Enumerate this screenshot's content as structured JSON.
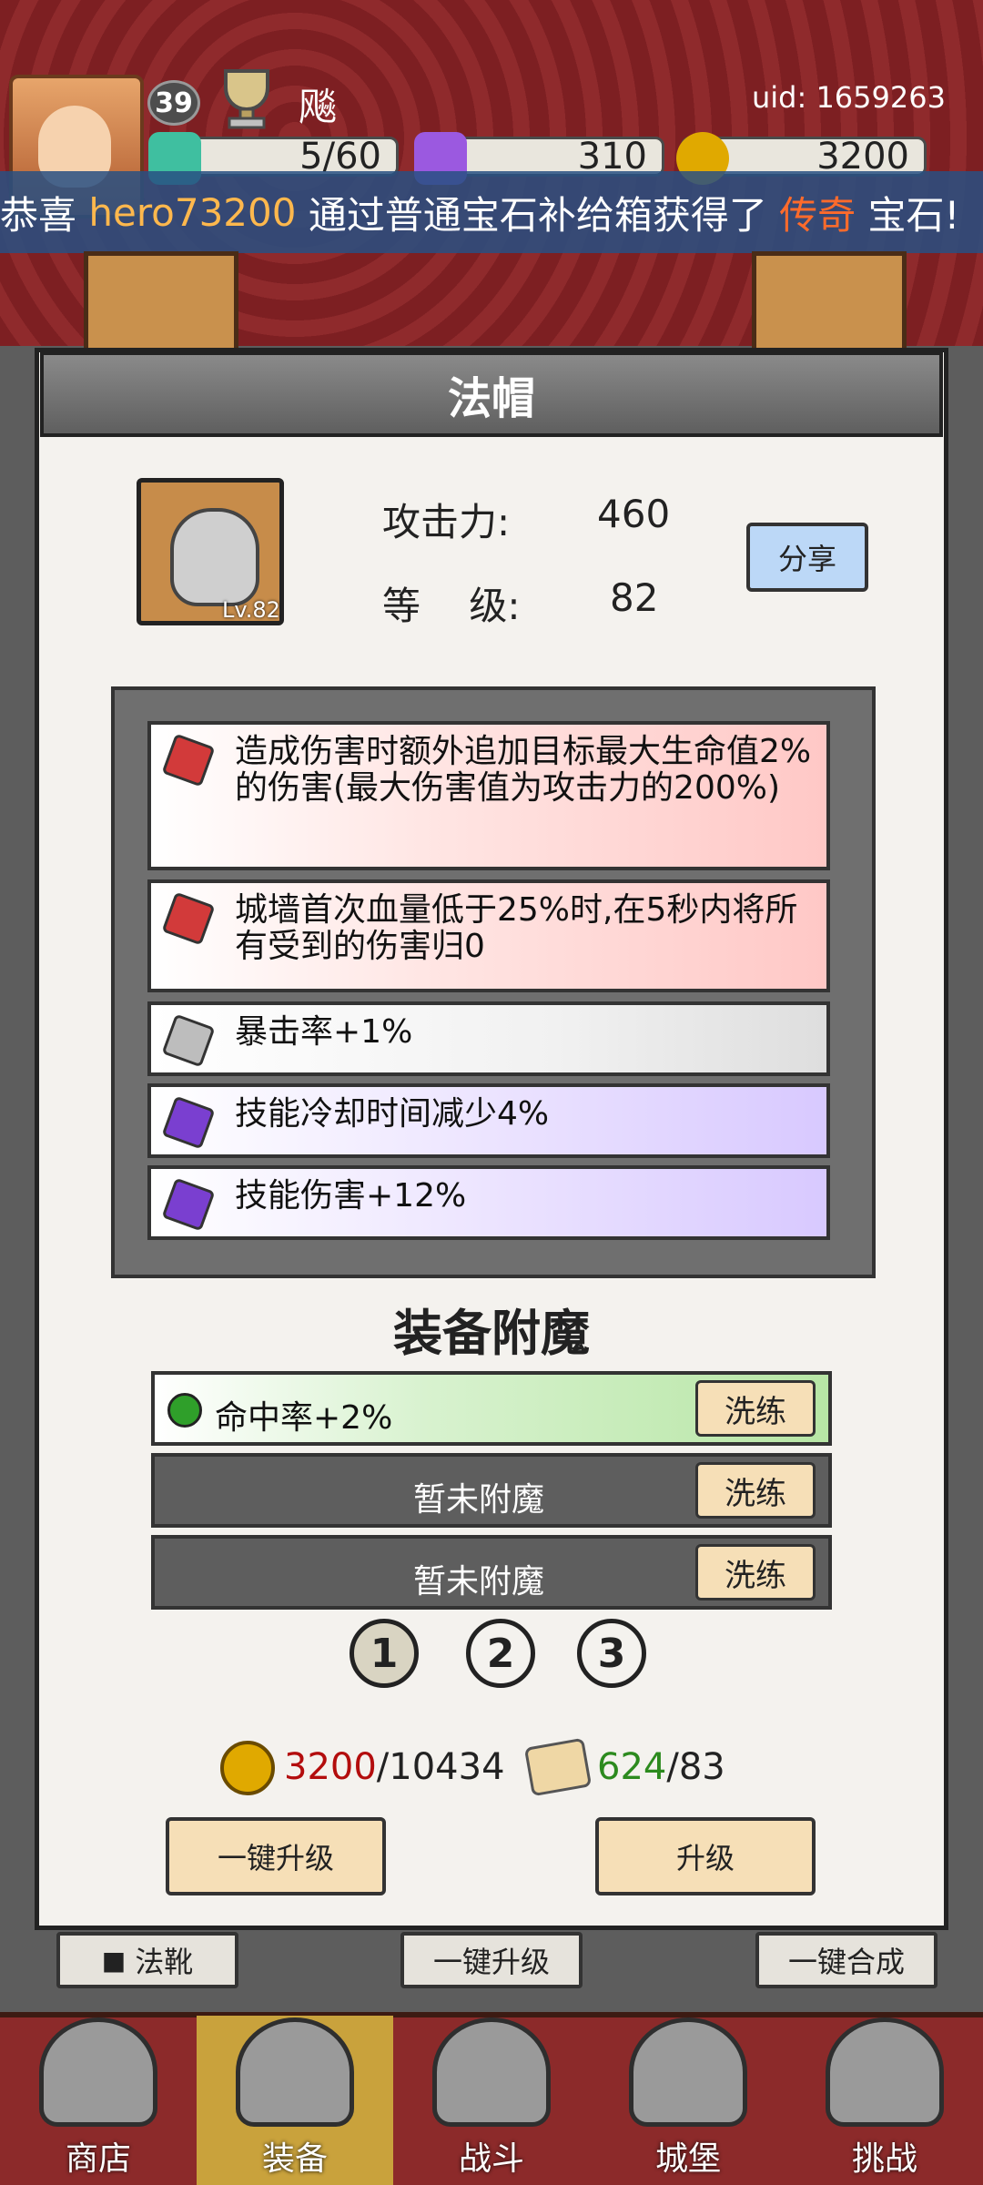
{
  "header": {
    "player_level": "39",
    "player_name": "飚",
    "uid": "uid: 1659263",
    "resources": [
      {
        "icon": "energy-gem-icon",
        "value": "5/60",
        "color": "#3fbfa0"
      },
      {
        "icon": "purple-diamond-icon",
        "value": "310",
        "color": "#9b59e0"
      },
      {
        "icon": "gold-coin-icon",
        "value": "3200",
        "color": "#e0a900"
      }
    ]
  },
  "broadcast": {
    "prefix": "恭喜 ",
    "player": "hero73200",
    "middle": " 通过普通宝石补给箱获得了 ",
    "rarity": "传奇",
    "suffix": " 宝石!"
  },
  "dialog": {
    "title": "法帽",
    "item_level": "Lv.82",
    "attack_label": "攻击力:",
    "attack_value": "460",
    "grade_label": "等    级:",
    "grade_value": "82",
    "share_label": "分享"
  },
  "affixes": [
    {
      "text": "造成伤害时额外追加目标最大生命值2%的伤害(最大伤害值为攻击力的200%)",
      "gem": "red-gem-icon",
      "color": "#d23a3a"
    },
    {
      "text": "城墙首次血量低于25%时,在5秒内将所有受到的伤害归0",
      "gem": "red-gem-icon",
      "color": "#d23a3a"
    },
    {
      "text": "暴击率+1%",
      "gem": "white-gem-icon",
      "color": "#bdbdbd"
    },
    {
      "text": "技能冷却时间减少4%",
      "gem": "purple-gem-icon",
      "color": "#7a3fd0"
    },
    {
      "text": "技能伤害+12%",
      "gem": "purple-gem-icon",
      "color": "#7a3fd0"
    }
  ],
  "enchant": {
    "title": "装备附魔",
    "rows": [
      {
        "text": "命中率+2%",
        "button": "洗练"
      },
      {
        "text": "暂未附魔",
        "button": "洗练"
      },
      {
        "text": "暂未附魔",
        "button": "洗练"
      }
    ],
    "pages": [
      "1",
      "2",
      "3"
    ]
  },
  "costs": {
    "gold_have": "3200",
    "gold_need": "10434",
    "scroll_have": "624",
    "scroll_need": "83"
  },
  "buttons": {
    "one_click_upgrade": "一键升级",
    "upgrade": "升级"
  },
  "sub_buttons": {
    "boots": "法靴",
    "one_click_upgrade": "一键升级",
    "one_click_merge": "一键合成"
  },
  "nav": [
    {
      "label": "商店",
      "icon": "shop-icon"
    },
    {
      "label": "装备",
      "icon": "equipment-bag-icon"
    },
    {
      "label": "战斗",
      "icon": "crossed-swords-icon"
    },
    {
      "label": "城堡",
      "icon": "castle-icon"
    },
    {
      "label": "挑战",
      "icon": "challenge-shield-icon"
    }
  ]
}
